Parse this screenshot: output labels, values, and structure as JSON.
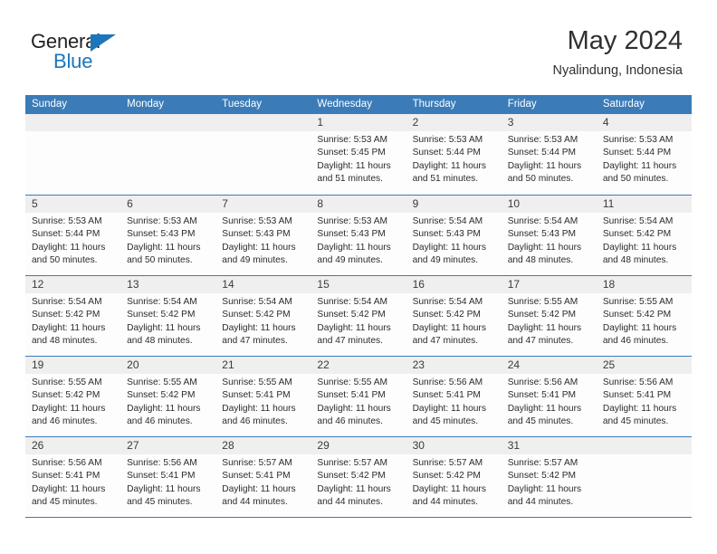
{
  "brand": {
    "name_top": "General",
    "name_bottom": "Blue",
    "accent_color": "#1c76bc"
  },
  "header": {
    "title": "May 2024",
    "location": "Nyalindung, Indonesia"
  },
  "theme": {
    "header_blue": "#3b7cb8",
    "daynum_band": "#efefef",
    "cell_background": "#fdfdfd"
  },
  "calendar": {
    "weekdays": [
      "Sunday",
      "Monday",
      "Tuesday",
      "Wednesday",
      "Thursday",
      "Friday",
      "Saturday"
    ],
    "weeks": [
      [
        {
          "day": "",
          "empty": true
        },
        {
          "day": "",
          "empty": true
        },
        {
          "day": "",
          "empty": true
        },
        {
          "day": "1",
          "sunrise": "Sunrise: 5:53 AM",
          "sunset": "Sunset: 5:45 PM",
          "daylight": "Daylight: 11 hours and 51 minutes."
        },
        {
          "day": "2",
          "sunrise": "Sunrise: 5:53 AM",
          "sunset": "Sunset: 5:44 PM",
          "daylight": "Daylight: 11 hours and 51 minutes."
        },
        {
          "day": "3",
          "sunrise": "Sunrise: 5:53 AM",
          "sunset": "Sunset: 5:44 PM",
          "daylight": "Daylight: 11 hours and 50 minutes."
        },
        {
          "day": "4",
          "sunrise": "Sunrise: 5:53 AM",
          "sunset": "Sunset: 5:44 PM",
          "daylight": "Daylight: 11 hours and 50 minutes."
        }
      ],
      [
        {
          "day": "5",
          "sunrise": "Sunrise: 5:53 AM",
          "sunset": "Sunset: 5:44 PM",
          "daylight": "Daylight: 11 hours and 50 minutes."
        },
        {
          "day": "6",
          "sunrise": "Sunrise: 5:53 AM",
          "sunset": "Sunset: 5:43 PM",
          "daylight": "Daylight: 11 hours and 50 minutes."
        },
        {
          "day": "7",
          "sunrise": "Sunrise: 5:53 AM",
          "sunset": "Sunset: 5:43 PM",
          "daylight": "Daylight: 11 hours and 49 minutes."
        },
        {
          "day": "8",
          "sunrise": "Sunrise: 5:53 AM",
          "sunset": "Sunset: 5:43 PM",
          "daylight": "Daylight: 11 hours and 49 minutes."
        },
        {
          "day": "9",
          "sunrise": "Sunrise: 5:54 AM",
          "sunset": "Sunset: 5:43 PM",
          "daylight": "Daylight: 11 hours and 49 minutes."
        },
        {
          "day": "10",
          "sunrise": "Sunrise: 5:54 AM",
          "sunset": "Sunset: 5:43 PM",
          "daylight": "Daylight: 11 hours and 48 minutes."
        },
        {
          "day": "11",
          "sunrise": "Sunrise: 5:54 AM",
          "sunset": "Sunset: 5:42 PM",
          "daylight": "Daylight: 11 hours and 48 minutes."
        }
      ],
      [
        {
          "day": "12",
          "sunrise": "Sunrise: 5:54 AM",
          "sunset": "Sunset: 5:42 PM",
          "daylight": "Daylight: 11 hours and 48 minutes."
        },
        {
          "day": "13",
          "sunrise": "Sunrise: 5:54 AM",
          "sunset": "Sunset: 5:42 PM",
          "daylight": "Daylight: 11 hours and 48 minutes."
        },
        {
          "day": "14",
          "sunrise": "Sunrise: 5:54 AM",
          "sunset": "Sunset: 5:42 PM",
          "daylight": "Daylight: 11 hours and 47 minutes."
        },
        {
          "day": "15",
          "sunrise": "Sunrise: 5:54 AM",
          "sunset": "Sunset: 5:42 PM",
          "daylight": "Daylight: 11 hours and 47 minutes."
        },
        {
          "day": "16",
          "sunrise": "Sunrise: 5:54 AM",
          "sunset": "Sunset: 5:42 PM",
          "daylight": "Daylight: 11 hours and 47 minutes."
        },
        {
          "day": "17",
          "sunrise": "Sunrise: 5:55 AM",
          "sunset": "Sunset: 5:42 PM",
          "daylight": "Daylight: 11 hours and 47 minutes."
        },
        {
          "day": "18",
          "sunrise": "Sunrise: 5:55 AM",
          "sunset": "Sunset: 5:42 PM",
          "daylight": "Daylight: 11 hours and 46 minutes."
        }
      ],
      [
        {
          "day": "19",
          "sunrise": "Sunrise: 5:55 AM",
          "sunset": "Sunset: 5:42 PM",
          "daylight": "Daylight: 11 hours and 46 minutes."
        },
        {
          "day": "20",
          "sunrise": "Sunrise: 5:55 AM",
          "sunset": "Sunset: 5:42 PM",
          "daylight": "Daylight: 11 hours and 46 minutes."
        },
        {
          "day": "21",
          "sunrise": "Sunrise: 5:55 AM",
          "sunset": "Sunset: 5:41 PM",
          "daylight": "Daylight: 11 hours and 46 minutes."
        },
        {
          "day": "22",
          "sunrise": "Sunrise: 5:55 AM",
          "sunset": "Sunset: 5:41 PM",
          "daylight": "Daylight: 11 hours and 46 minutes."
        },
        {
          "day": "23",
          "sunrise": "Sunrise: 5:56 AM",
          "sunset": "Sunset: 5:41 PM",
          "daylight": "Daylight: 11 hours and 45 minutes."
        },
        {
          "day": "24",
          "sunrise": "Sunrise: 5:56 AM",
          "sunset": "Sunset: 5:41 PM",
          "daylight": "Daylight: 11 hours and 45 minutes."
        },
        {
          "day": "25",
          "sunrise": "Sunrise: 5:56 AM",
          "sunset": "Sunset: 5:41 PM",
          "daylight": "Daylight: 11 hours and 45 minutes."
        }
      ],
      [
        {
          "day": "26",
          "sunrise": "Sunrise: 5:56 AM",
          "sunset": "Sunset: 5:41 PM",
          "daylight": "Daylight: 11 hours and 45 minutes."
        },
        {
          "day": "27",
          "sunrise": "Sunrise: 5:56 AM",
          "sunset": "Sunset: 5:41 PM",
          "daylight": "Daylight: 11 hours and 45 minutes."
        },
        {
          "day": "28",
          "sunrise": "Sunrise: 5:57 AM",
          "sunset": "Sunset: 5:41 PM",
          "daylight": "Daylight: 11 hours and 44 minutes."
        },
        {
          "day": "29",
          "sunrise": "Sunrise: 5:57 AM",
          "sunset": "Sunset: 5:42 PM",
          "daylight": "Daylight: 11 hours and 44 minutes."
        },
        {
          "day": "30",
          "sunrise": "Sunrise: 5:57 AM",
          "sunset": "Sunset: 5:42 PM",
          "daylight": "Daylight: 11 hours and 44 minutes."
        },
        {
          "day": "31",
          "sunrise": "Sunrise: 5:57 AM",
          "sunset": "Sunset: 5:42 PM",
          "daylight": "Daylight: 11 hours and 44 minutes."
        },
        {
          "day": "",
          "empty": true
        }
      ]
    ]
  }
}
